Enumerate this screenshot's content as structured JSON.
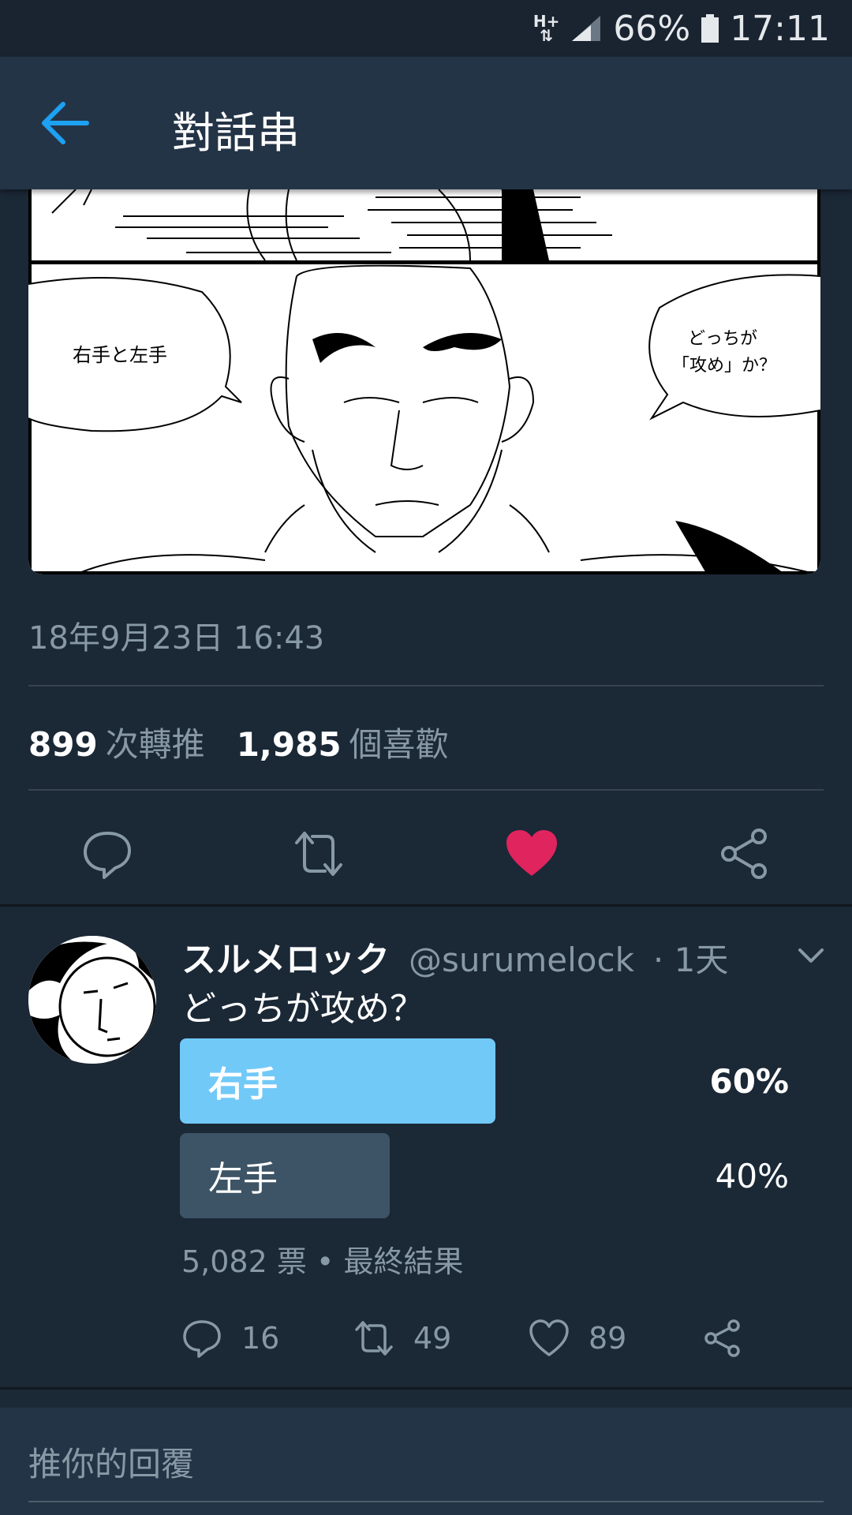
{
  "status_bar": {
    "network": "H+",
    "battery": "66%",
    "time": "17:11"
  },
  "app_bar": {
    "title": "對話串",
    "back_icon": "arrow-left-icon"
  },
  "main_tweet": {
    "media_bubbles": {
      "left": "右手と左手",
      "right_line1": "どっちが",
      "right_line2": "「攻め」か？"
    },
    "date": "18年9月23日 16:43",
    "retweet_count": "899",
    "retweet_label": "次轉推",
    "like_count": "1,985",
    "like_label": "個喜歡",
    "actions": [
      "reply-icon",
      "retweet-icon",
      "heart-filled-icon",
      "share-icon"
    ],
    "liked_color": "#e0245e"
  },
  "reply_tweet": {
    "display_name": "スルメロック",
    "handle": "@surumelock",
    "time": "· 1天",
    "text": "どっちが攻め？",
    "poll": {
      "options": [
        {
          "label": "右手",
          "percent": "60%",
          "value": 60,
          "color": "#71c9f8",
          "winner": true
        },
        {
          "label": "左手",
          "percent": "40%",
          "value": 40,
          "color": "#3d5466",
          "winner": false
        }
      ],
      "meta": "5,082 票 • 最終結果"
    },
    "actions": {
      "reply_count": "16",
      "retweet_count": "49",
      "like_count": "89"
    }
  },
  "reply_box": {
    "placeholder": "推你的回覆"
  },
  "colors": {
    "background": "#1b2836",
    "appbar": "#243447",
    "accent": "#1da1f2",
    "secondary_text": "#8899a6"
  }
}
